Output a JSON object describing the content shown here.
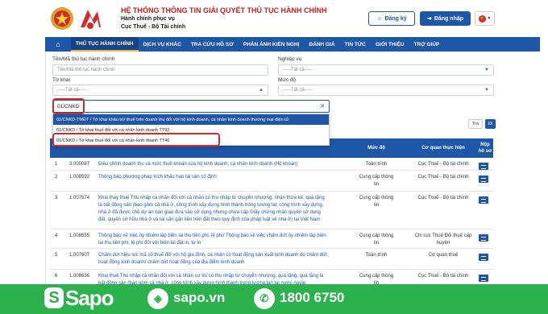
{
  "header": {
    "title": "HỆ THỐNG THÔNG TIN GIẢI QUYẾT THỦ TỤC HÀNH CHÍNH",
    "subtitle1": "Hành chính phục vụ",
    "subtitle2": "Cục Thuế - Bộ Tài chính",
    "register_label": "Đăng ký",
    "login_label": "Đăng nhập"
  },
  "nav": {
    "items": [
      {
        "label": "THỦ TỤC HÀNH CHÍNH",
        "active": true
      },
      {
        "label": "DỊCH VỤ KHÁC"
      },
      {
        "label": "TRA CỨU HỒ SƠ"
      },
      {
        "label": "PHẢN ÁNH KIẾN NGHỊ"
      },
      {
        "label": "ĐÁNH GIÁ"
      },
      {
        "label": "TIN TỨC"
      },
      {
        "label": "GIỚI THIỆU"
      },
      {
        "label": "TRỢ GIÚP"
      }
    ]
  },
  "filters": {
    "name_label": "Tên/Mã thủ tục hành chính",
    "name_placeholder": "Tên/Mã thủ tục hành chính",
    "business_label": "Nghiệp vụ",
    "business_value": "-----Tất cả-----",
    "form_label": "Tờ khai",
    "form_value": "-----Tất cả-----",
    "level_label": "Mức độ",
    "level_value": "-----Tất cả-----"
  },
  "dropdown": {
    "input_value": "01/CNKD",
    "options": [
      "01/CNKD-TMĐT / Tờ khai khấu trừ thuế trên doanh thu đối với hộ kinh doanh, cá nhân kinh doanh thương mại điện tử",
      "01/CNKD / Tờ khai thuế đối với cá nhân kinh doanh TT92",
      "01/CNKD / Tờ khai thuế đối với cá nhân kinh doanh TT40"
    ]
  },
  "search": {
    "btn1": "Tra",
    "btn2": "Đi"
  },
  "table": {
    "headers": [
      "Mức độ",
      "Cơ quan thực hiện",
      "Nộp hồ sơ"
    ],
    "rows": [
      {
        "no": "1",
        "code": "3.000087",
        "name": "Điều chỉnh doanh thu và mức thuế khoán của hộ kinh doanh, cá nhân kinh doanh (Hộ khoán)",
        "level": "Toàn trình",
        "agency": "Cục Thuế - Bộ tài chính"
      },
      {
        "no": "2",
        "code": "1.008592",
        "name": "Thông báo phương pháp trích khấu hao tài sản cố định",
        "level": "Cung cấp thông tin",
        "agency": "Cục Thuế - Bộ tài chính"
      },
      {
        "no": "3",
        "code": "1.007674",
        "name": "Khai thay thuế Thu nhập cá nhân đối với cá nhân có thu nhập từ chuyển nhượng, nhận thừa kế, quà tặng là bất động sản (bao gồm cả nhà ở, công trình xây dựng hình thành trong tương lai; công trình xây dựng, nhà ở đã được chủ dự án bàn giao đưa vào sử dụng nhưng chưa cấp Giấy chứng nhận quyền sử dụng đất, quyền sở hữu nhà ở và tài sản gắn liền trên đất theo quy định của pháp luật về nhà ở) tại Việt Nam",
        "level": "Cung cấp thông tin",
        "agency": "Cục Thuế - Bộ tài chính"
      },
      {
        "no": "4",
        "code": "1.008555",
        "name": "Thông báo về việc ủy nhiệm lập biên lai thu tiền phí, lệ phí/ Thông báo về việc chấm dứt ủy nhiệm lập biên lai thu tiền phí, lệ phí đối với biên lai đặt in, tự in",
        "level": "Cung cấp thông tin",
        "agency": "Chi cục Thuế Đối thuế cấp huyện"
      },
      {
        "no": "5",
        "code": "1.007607",
        "name": "Chấm dứt hiệu lực mã số thuế đối với hộ gia đình, cá nhân có hoạt động sản xuất kinh doanh do chấm dứt hoạt động kinh doanh/ chấm dứt hoạt động của địa điểm kinh doanh",
        "level": "Toàn trình",
        "agency": "Cơ quan thuế"
      },
      {
        "no": "6",
        "code": "1.008636",
        "name": "Khai thuế Thu nhập cá nhân đối với cá nhân cư trú có thu nhập từ chuyển nhượng, quà tặng, quà tặng là bất động sản (bao gồm cả nhà ở, công trình xây dựng hình thành trong tương lai) tại nước ngoài",
        "level": "Cung cấp thông tin",
        "agency": "Cục Thuế - Bộ tài chính"
      }
    ]
  },
  "footer": {
    "brand": "Sapo",
    "site": "sapo.vn",
    "phone": "1800 6750"
  }
}
